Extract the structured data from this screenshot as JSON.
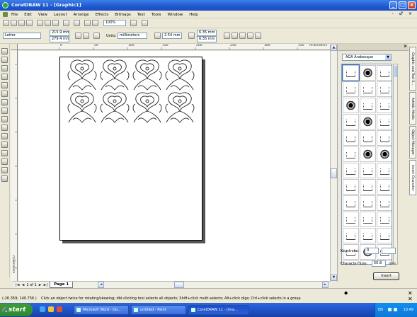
{
  "window": {
    "title": "CorelDRAW 11 - [Graphic1]",
    "controls": [
      "_",
      "□",
      "×"
    ]
  },
  "menu": {
    "items": [
      "File",
      "Edit",
      "View",
      "Layout",
      "Arrange",
      "Effects",
      "Bitmaps",
      "Text",
      "Tools",
      "Window",
      "Help"
    ],
    "doc_controls": "- ♂ ×"
  },
  "standard_toolbar": {
    "zoom_value": "100%"
  },
  "property_bar": {
    "paper_size": "Letter",
    "width": "215.9 mm",
    "height": "279.4 mm",
    "units_label": "Units:",
    "units_value": "millimeters",
    "nudge": "2.54 mm",
    "dup_x": "6.35 mm",
    "dup_y": "6.35 mm"
  },
  "rulers": {
    "h_ticks": [
      "0",
      "50",
      "100",
      "150",
      "200",
      "250",
      "300",
      "350",
      "400"
    ],
    "h_units": "millimeters",
    "v_units": "millimeters"
  },
  "page_nav": {
    "counter": "1 of 1",
    "tab_label": "Page 1"
  },
  "docker": {
    "font_name": "AGA Arabesque",
    "tabs": [
      "Graphic and Text S...",
      "Artistic Media",
      "Object Manager",
      "Insert Character"
    ],
    "keystroke_label": "Keystroke:",
    "keystroke_value": "0",
    "char_size_label": "Character Size:",
    "char_size_value": "50.8",
    "char_size_unit": "mm",
    "insert_label": "Insert",
    "glyph_pattern": [
      "light",
      "dark",
      "light",
      "light",
      "light",
      "light",
      "dark",
      "light",
      "light",
      "light",
      "dark",
      "light",
      "light",
      "light",
      "light",
      "light",
      "dark",
      "dark",
      "light",
      "light",
      "light",
      "light",
      "light",
      "light",
      "light",
      "light",
      "light",
      "light",
      "light",
      "light",
      "light",
      "light",
      "light",
      "light",
      "dark",
      "light",
      "dark",
      "light",
      "light",
      "light",
      "light",
      "light"
    ]
  },
  "status": {
    "coords": "(-26.359; 140.756 )",
    "hint": "Click an object twice for rotating/skewing; dbl-clicking tool selects all objects; Shift+click multi-selects; Alt+click digs; Ctrl+click selects in a group"
  },
  "taskbar": {
    "start_label": "start",
    "tasks": [
      {
        "label": "Microsoft Word - Do...",
        "active": false
      },
      {
        "label": "untitled - Paint",
        "active": false
      },
      {
        "label": "CorelDRAW 11 - [Gra...",
        "active": true
      }
    ],
    "tray_lang": "EN",
    "clock": "10:49"
  },
  "colors": {
    "title_blue": "#1e58d0",
    "xp_green": "#2e8a2e",
    "chrome": "#ece9d8"
  }
}
